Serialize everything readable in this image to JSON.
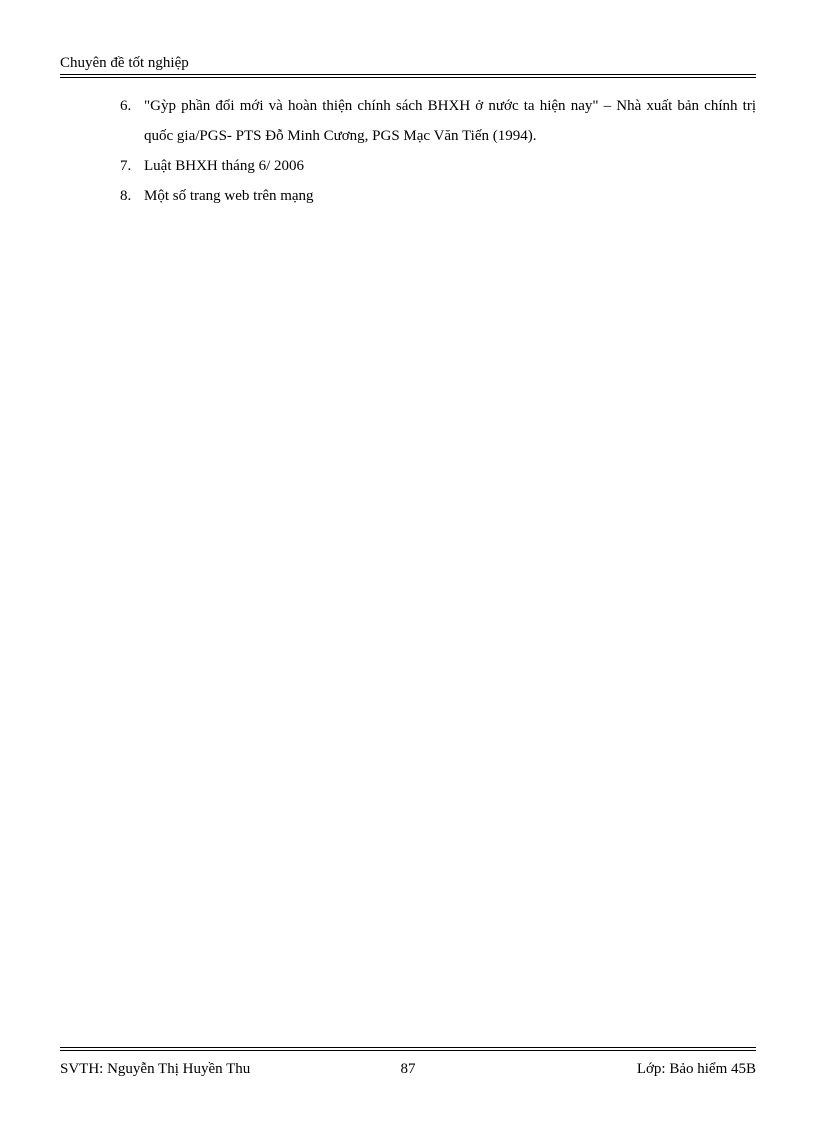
{
  "header": {
    "title": "Chuyên đề tốt nghiệp"
  },
  "content": {
    "items": [
      {
        "marker": "6.",
        "text": "\"Gỳp phần đổi mới và hoàn thiện chính sách BHXH ở nước ta hiện nay\" – Nhà xuất bản chính trị quốc gia/PGS- PTS Đỗ Minh Cương, PGS Mạc Văn Tiến (1994)."
      },
      {
        "marker": "7.",
        "text": "Luật BHXH tháng 6/ 2006"
      },
      {
        "marker": "8.",
        "text": "Một số trang web trên mạng"
      }
    ]
  },
  "footer": {
    "left": "SVTH: Nguyễn Thị Huyền Thu",
    "center": "87",
    "right": "Lớp: Bảo hiểm 45B"
  }
}
